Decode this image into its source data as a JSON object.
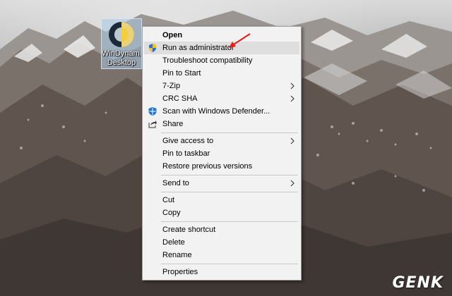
{
  "desktop": {
    "icon_label": "WinDynamic\nDesktop",
    "icon_name": "windynamicdesktop-icon"
  },
  "context_menu": {
    "items": [
      {
        "label": "Open",
        "bold": true
      },
      {
        "label": "Run as administrator",
        "icon": "uac-shield-icon",
        "hover": true
      },
      {
        "label": "Troubleshoot compatibility"
      },
      {
        "label": "Pin to Start"
      },
      {
        "label": "7-Zip",
        "submenu": true
      },
      {
        "label": "CRC SHA",
        "submenu": true
      },
      {
        "label": "Scan with Windows Defender...",
        "icon": "windows-defender-icon"
      },
      {
        "label": "Share",
        "icon": "share-icon"
      },
      {
        "label": "Give access to",
        "submenu": true
      },
      {
        "label": "Pin to taskbar"
      },
      {
        "label": "Restore previous versions"
      },
      {
        "label": "Send to",
        "submenu": true
      },
      {
        "label": "Cut"
      },
      {
        "label": "Copy"
      },
      {
        "label": "Create shortcut"
      },
      {
        "label": "Delete"
      },
      {
        "label": "Rename"
      },
      {
        "label": "Properties"
      }
    ]
  },
  "colors": {
    "menu_bg": "#f2f2f2",
    "hover_bg": "#dedede",
    "annotation_arrow": "#e0201c"
  },
  "watermark": "GENK"
}
